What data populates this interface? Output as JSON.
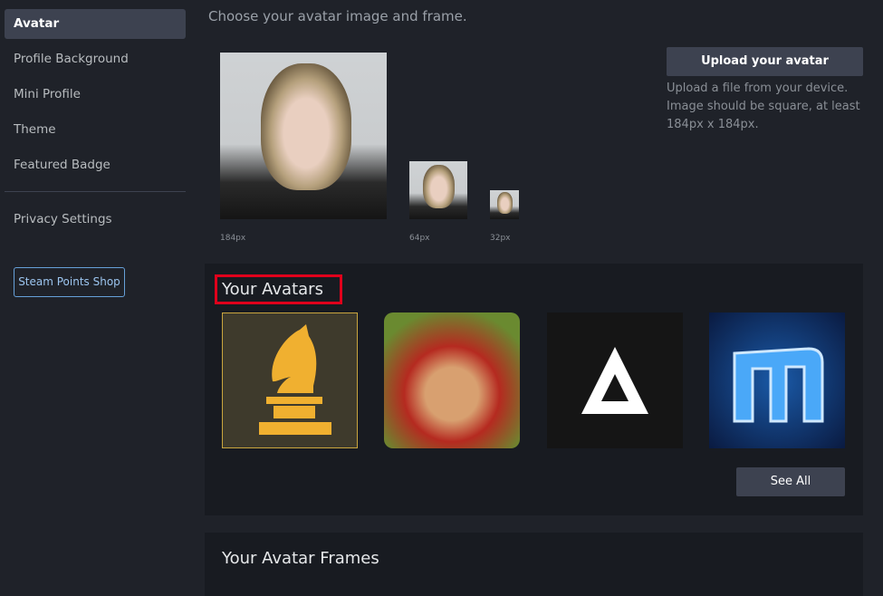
{
  "sidebar": {
    "items": [
      {
        "label": "Avatar"
      },
      {
        "label": "Profile Background"
      },
      {
        "label": "Mini Profile"
      },
      {
        "label": "Theme"
      },
      {
        "label": "Featured Badge"
      },
      {
        "label": "Privacy Settings"
      }
    ],
    "shop_button": "Steam Points Shop"
  },
  "main": {
    "intro": "Choose your avatar image and frame.",
    "previews": [
      {
        "size": "184px"
      },
      {
        "size": "64px"
      },
      {
        "size": "32px"
      }
    ],
    "upload_button": "Upload your avatar",
    "upload_hint": "Upload a file from your device. Image should be square, at least 184px x 184px.",
    "your_avatars": {
      "title": "Your Avatars",
      "items": [
        {
          "icon": "chess-knight-icon"
        },
        {
          "icon": "red-riding-hood-icon"
        },
        {
          "icon": "triangle-logo-icon"
        },
        {
          "icon": "blue-m-logo-icon"
        }
      ],
      "see_all": "See All"
    },
    "frames_title": "Your Avatar Frames"
  },
  "colors": {
    "highlight": "#e0001b",
    "selected_border": "#c9a53e",
    "accent": "#66a0d8"
  }
}
